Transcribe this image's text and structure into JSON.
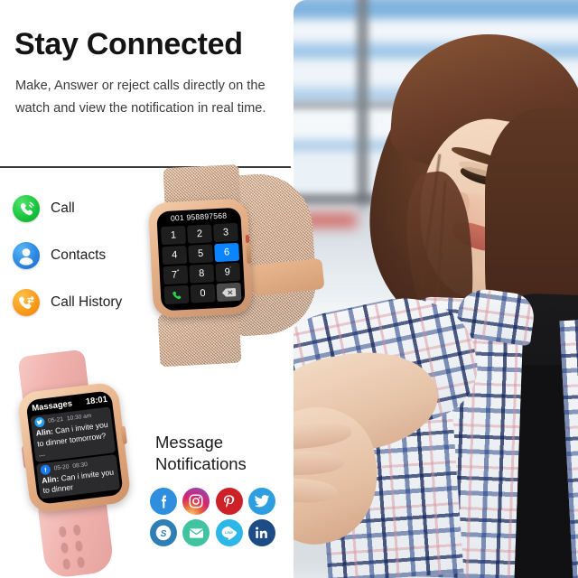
{
  "headline": "Stay Connected",
  "subtext": "Make, Answer or reject calls directly on the watch and view the notification in real time.",
  "features": [
    {
      "label": "Call",
      "icon": "phone-call-icon",
      "color": "#18c23c"
    },
    {
      "label": "Contacts",
      "icon": "contacts-person-icon",
      "color": "#2a86e0"
    },
    {
      "label": "Call History",
      "icon": "call-history-icon",
      "color": "#f79a1b"
    }
  ],
  "dialer_watch": {
    "number": "001 958897568",
    "keys": [
      {
        "label": "1",
        "sup": ""
      },
      {
        "label": "2",
        "sup": ""
      },
      {
        "label": "3",
        "sup": ""
      },
      {
        "label": "4",
        "sup": ""
      },
      {
        "label": "5",
        "sup": ""
      },
      {
        "label": "6",
        "sup": "",
        "highlight": true
      },
      {
        "label": "7",
        "sup": "*"
      },
      {
        "label": "8",
        "sup": ""
      },
      {
        "label": "9",
        "sup": "'"
      }
    ],
    "call_key": "call-icon",
    "zero_key": "0",
    "backspace_key": "backspace-icon",
    "highlight_color": "#0a84ff"
  },
  "message_watch": {
    "title": "Massages",
    "time": "18:01",
    "messages": [
      {
        "app": "twitter",
        "date": "05-21",
        "hour": "10:30 am",
        "sender": "Alin:",
        "text": "Can i invite you to dinner tomorrow?  ..."
      },
      {
        "app": "facebook",
        "date": "05-20",
        "hour": "08:30",
        "sender": "Alin:",
        "text": "Can i invite you to dinner"
      }
    ]
  },
  "notifications": {
    "title_line1": "Message",
    "title_line2": "Notifications",
    "apps": [
      {
        "name": "facebook",
        "glyph": "f"
      },
      {
        "name": "instagram",
        "glyph": ""
      },
      {
        "name": "pinterest",
        "glyph": "P"
      },
      {
        "name": "twitter",
        "glyph": ""
      },
      {
        "name": "skype",
        "glyph": "S"
      },
      {
        "name": "email",
        "glyph": ""
      },
      {
        "name": "line",
        "glyph": "LINE"
      },
      {
        "name": "linkedin",
        "glyph": "in"
      }
    ]
  }
}
